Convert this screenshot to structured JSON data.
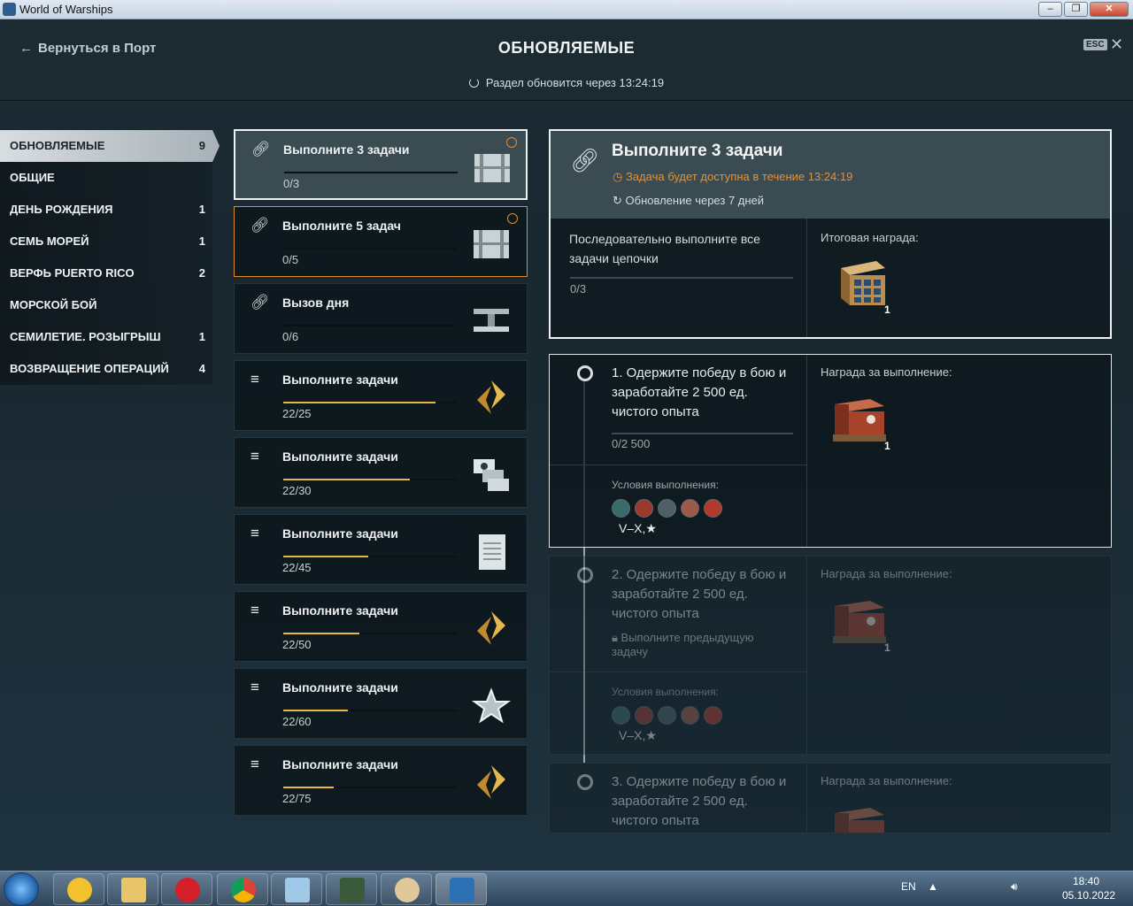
{
  "window": {
    "title": "World of Warships",
    "minimize": "–",
    "maximize": "❐",
    "close": "✕"
  },
  "header": {
    "back_label": "Вернуться в Порт",
    "title": "ОБНОВЛЯЕМЫЕ",
    "esc_label": "ESC",
    "refresh_text": "Раздел обновится через 13:24:19"
  },
  "sidebar": {
    "items": [
      {
        "label": "ОБНОВЛЯЕМЫЕ",
        "count": "9",
        "active": true
      },
      {
        "label": "ОБЩИЕ",
        "count": ""
      },
      {
        "label": "ДЕНЬ РОЖДЕНИЯ",
        "count": "1"
      },
      {
        "label": "СЕМЬ МОРЕЙ",
        "count": "1"
      },
      {
        "label": "ВЕРФЬ PUERTO RICO",
        "count": "2"
      },
      {
        "label": "МОРСКОЙ БОЙ",
        "count": ""
      },
      {
        "label": "СЕМИЛЕТИЕ. РОЗЫГРЫШ",
        "count": "1"
      },
      {
        "label": "ВОЗВРАЩЕНИЕ ОПЕРАЦИЙ",
        "count": "4"
      }
    ]
  },
  "cards": [
    {
      "title": "Выполните 3 задачи",
      "progress": "0/3",
      "fraction": 0,
      "icon": "chain-icon",
      "reward": "container-icon",
      "timer": true
    },
    {
      "title": "Выполните 5 задач",
      "progress": "0/5",
      "fraction": 0,
      "icon": "chain-icon",
      "reward": "container-icon",
      "timer": true
    },
    {
      "title": "Вызов дня",
      "progress": "0/6",
      "fraction": 0,
      "icon": "chain-icon",
      "reward": "steel-icon",
      "timer": false
    },
    {
      "title": "Выполните задачи",
      "progress": "22/25",
      "fraction": 0.88,
      "icon": "list-icon",
      "reward": "coal-icon",
      "timer": false
    },
    {
      "title": "Выполните задачи",
      "progress": "22/30",
      "fraction": 0.73,
      "icon": "list-icon",
      "reward": "signals-icon",
      "timer": false
    },
    {
      "title": "Выполните задачи",
      "progress": "22/45",
      "fraction": 0.49,
      "icon": "list-icon",
      "reward": "document-icon",
      "timer": false
    },
    {
      "title": "Выполните задачи",
      "progress": "22/50",
      "fraction": 0.44,
      "icon": "list-icon",
      "reward": "coal-icon",
      "timer": false
    },
    {
      "title": "Выполните задачи",
      "progress": "22/60",
      "fraction": 0.37,
      "icon": "list-icon",
      "reward": "star-icon",
      "timer": false
    },
    {
      "title": "Выполните задачи",
      "progress": "22/75",
      "fraction": 0.29,
      "icon": "list-icon",
      "reward": "coal-icon",
      "timer": false
    }
  ],
  "detail": {
    "title": "Выполните 3 задачи",
    "availability": "Задача будет доступна в течение 13:24:19",
    "update": "Обновление через 7 дней",
    "description": "Последовательно выполните все задачи цепочки",
    "progress": "0/3",
    "final_reward_label": "Итоговая награда:",
    "final_reward_count": "1"
  },
  "tasks": [
    {
      "title": "1. Одержите победу в бою и заработайте 2 500 ед. чистого опыта",
      "progress": "0/2 500",
      "reward_label": "Награда за выполнение:",
      "reward_count": "1",
      "conditions_label": "Условия выполнения:",
      "conditions_value": "V–X,★"
    },
    {
      "title": "2. Одержите победу в бою и заработайте 2 500 ед. чистого опыта",
      "locked": "Выполните предыдущую задачу",
      "reward_label": "Награда за выполнение:",
      "reward_count": "1",
      "conditions_label": "Условия выполнения:",
      "conditions_value": "V–X,★"
    },
    {
      "title": "3. Одержите победу в бою и заработайте 2 500 ед. чистого опыта",
      "reward_label": "Награда за выполнение:"
    }
  ],
  "taskbar": {
    "lang": "EN",
    "time": "18:40",
    "date": "05.10.2022"
  },
  "colors": {
    "accent_orange": "#e48b2c",
    "progress_yellow": "#e6b74c",
    "panel": "#3a4b52"
  }
}
